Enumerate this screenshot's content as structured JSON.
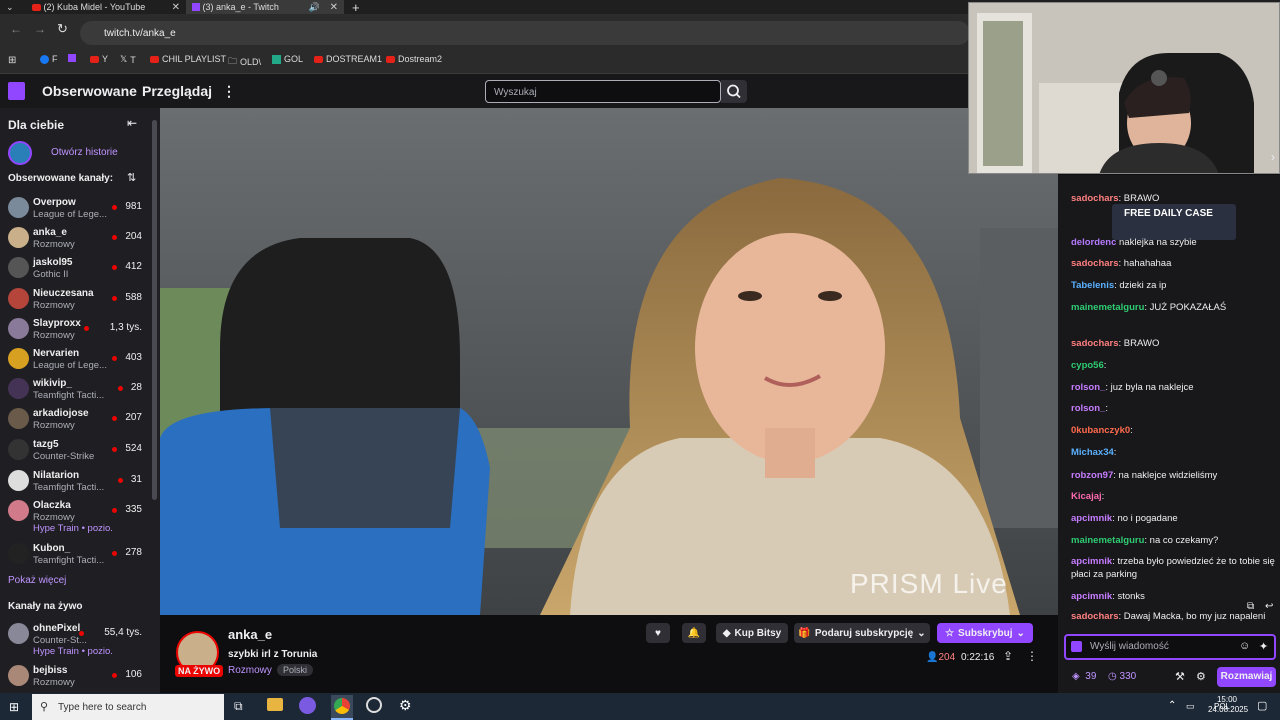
{
  "browser": {
    "tabs": [
      {
        "label": "(2) Kuba Midel - YouTube"
      },
      {
        "label": "(3) anka_e - Twitch"
      }
    ],
    "url": "twitch.tv/anka_e",
    "bookmarks": [
      "F",
      "Y",
      "T",
      "CHIL PLAYLIST",
      "OLD\\",
      "GOL",
      "DOSTREAM1",
      "Dostream2"
    ]
  },
  "nav": {
    "followed": "Obserwowane",
    "browse": "Przeglądaj",
    "search_placeholder": "Wyszukaj"
  },
  "sidebar": {
    "for_you": "Dla ciebie",
    "open_stories": "Otwórz historie",
    "followed_channels": "Obserwowane kanały:",
    "channels": [
      {
        "name": "Overpow",
        "game": "League of Lege...",
        "viewers": "981",
        "color": "#7a8a9a"
      },
      {
        "name": "anka_e",
        "game": "Rozmowy",
        "viewers": "204",
        "color": "#c9b08a"
      },
      {
        "name": "jaskol95",
        "game": "Gothic II",
        "viewers": "412",
        "color": "#555"
      },
      {
        "name": "Nieuczesana",
        "game": "Rozmowy",
        "viewers": "588",
        "color": "#b5453a"
      },
      {
        "name": "Slayproxx",
        "game": "Rozmowy",
        "viewers": "1,3 tys.",
        "color": "#8a7a9a"
      },
      {
        "name": "Nervarien",
        "game": "League of Lege...",
        "viewers": "403",
        "color": "#d8a020"
      },
      {
        "name": "wikivip_",
        "game": "Teamfight Tacti...",
        "viewers": "28",
        "color": "#443355"
      },
      {
        "name": "arkadiojose",
        "game": "Rozmowy",
        "viewers": "207",
        "color": "#6a5a4a"
      },
      {
        "name": "tazg5",
        "game": "Counter-Strike",
        "viewers": "524",
        "color": "#333"
      },
      {
        "name": "Nilatarion",
        "game": "Teamfight Tacti...",
        "viewers": "31",
        "color": "#dddddd"
      },
      {
        "name": "Olaczka",
        "game": "Rozmowy",
        "viewers": "335",
        "hype": "Hype Train • pozio...",
        "color": "#d07a8a"
      },
      {
        "name": "Kubon_",
        "game": "Teamfight Tacti...",
        "viewers": "278",
        "color": "#222"
      }
    ],
    "show_more": "Pokaż więcej",
    "live_channels": "Kanały na żywo",
    "live": [
      {
        "name": "ohnePixel",
        "game": "Counter-St...",
        "viewers": "55,4 tys.",
        "hype": "Hype Train • pozio...",
        "color": "#889"
      },
      {
        "name": "bejbiss",
        "game": "Rozmowy",
        "viewers": "106",
        "color": "#a87"
      }
    ]
  },
  "video": {
    "watermark": "PRISM Live"
  },
  "stream": {
    "channel": "anka_e",
    "title": "szybki irl z Torunia",
    "category": "Rozmowy",
    "tag": "Polski",
    "live_badge": "NA ŻYWO",
    "viewers": "204",
    "uptime": "0:22:16",
    "buy_bits": "Kup Bitsy",
    "gift_sub": "Podaruj subskrypcję",
    "subscribe": "Subskrybuj"
  },
  "chat": {
    "messages": [
      {
        "user": "sadochars",
        "text": ": BRAWO",
        "color": "#ff7f7f"
      },
      {
        "user": "delordenc",
        "text": " naklejka na szybie",
        "color": "#b57aff"
      },
      {
        "user": "sadochars",
        "text": ": hahahahaa",
        "color": "#ff7f7f"
      },
      {
        "user": "Tabelenis",
        "text": ": dzieki za ip",
        "color": "#5ab0ff"
      },
      {
        "user": "mainemetalguru",
        "text": ": JUŻ POKAZAŁAŚ",
        "color": "#2ecc71"
      },
      {
        "user": "sadochars",
        "text": ": BRAWO",
        "color": "#ff7f7f"
      },
      {
        "user": "cypo56",
        "text": ":",
        "color": "#2ecc71"
      },
      {
        "user": "rolson_",
        "text": ": juz byla na naklejce",
        "color": "#c77dff"
      },
      {
        "user": "rolson_",
        "text": ":",
        "color": "#c77dff"
      },
      {
        "user": "0kubanczyk0",
        "text": ":",
        "color": "#ff6a4d"
      },
      {
        "user": "Michax34",
        "text": ":",
        "color": "#5ab0ff"
      },
      {
        "user": "robzon97",
        "text": ": na naklejce widzieliśmy",
        "color": "#c77dff"
      },
      {
        "user": "Kicajaj",
        "text": ":",
        "color": "#ff6ab0"
      },
      {
        "user": "apcimnik",
        "text": ": no i pogadane",
        "color": "#c77dff"
      },
      {
        "user": "mainemetalguru",
        "text": ": na co czekamy?",
        "color": "#2ecc71"
      },
      {
        "user": "apcimnik",
        "text": ": trzeba było powiedzieć że to tobie się płaci za parking",
        "color": "#c77dff"
      },
      {
        "user": "apcimnik",
        "text": ": stonks",
        "color": "#c77dff"
      },
      {
        "user": "sadochars",
        "text": ": Dawaj Macka, bo my juz napaleni",
        "color": "#ff7f7f"
      }
    ],
    "placeholder": "Wyślij wiadomość",
    "points": "39",
    "watch_count": "330",
    "chat_button": "Rozmawiaj",
    "ad_text": "FREE DAILY CASE"
  },
  "taskbar": {
    "search_placeholder": "Type here to search",
    "lang": "POL",
    "time": "15:00",
    "date": "24.08.2025"
  }
}
